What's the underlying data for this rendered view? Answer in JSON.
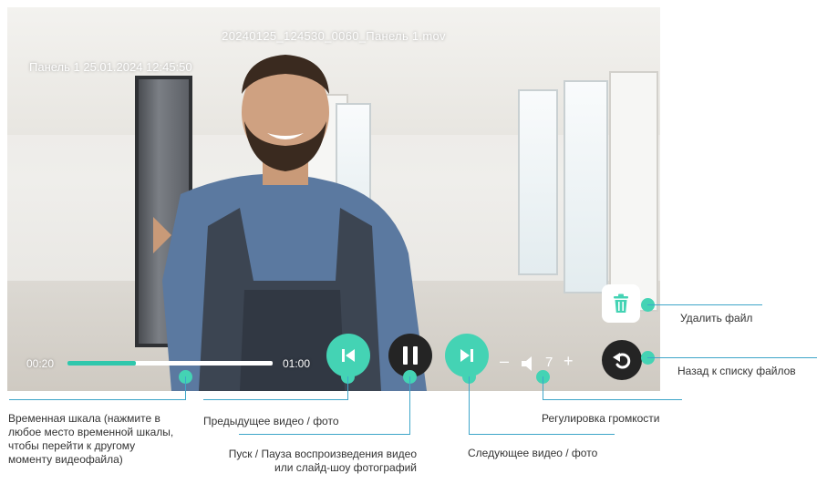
{
  "player": {
    "filename": "20240125_124530_0060_Панель 1.mov",
    "overlay_timestamp": "Панель 1 25.01.2024 12:45:50",
    "time_current": "00:20",
    "time_total": "01:00",
    "progress_fraction": 0.333,
    "volume_minus": "–",
    "volume_value": "7",
    "volume_plus": "+"
  },
  "callouts": {
    "delete_file": "Удалить файл",
    "back_to_list": "Назад к списку файлов",
    "timeline": "Временная шкала (нажмите в любое место временной шкалы, чтобы перейти к другому моменту видеофайла)",
    "prev": "Предыдущее видео / фото",
    "play_pause": "Пуск / Пауза воспроизведения видео или слайд-шоу фотографий",
    "next": "Следующее видео / фото",
    "volume": "Регулировка громкости"
  },
  "colors": {
    "accent": "#44d3b4",
    "callout_line": "#3ea6c9",
    "dark_button": "#242424"
  },
  "icons": [
    "skip-previous-icon",
    "pause-icon",
    "skip-next-icon",
    "speaker-icon",
    "trash-icon",
    "back-arrow-icon"
  ]
}
